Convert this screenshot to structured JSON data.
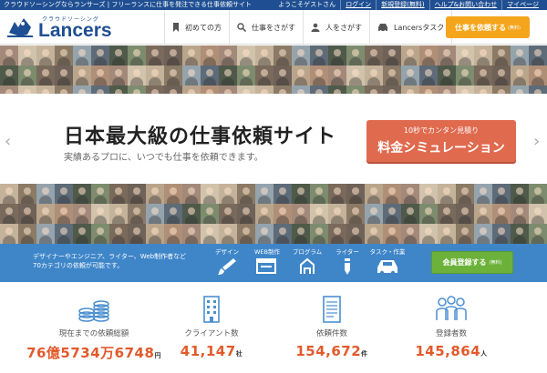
{
  "topbar": {
    "tagline": "クラウドソーシングならランサーズ | フリーランスに仕事を発注できる仕事依頼サイト",
    "links": [
      "ようこそゲストさん",
      "ログイン",
      "新規登録(無料)",
      "ヘルプ&お問い合わせ",
      "マイページ"
    ]
  },
  "header": {
    "logo_sub": "クラウドソーシング",
    "logo_text": "Lancers",
    "nav": [
      {
        "label": "初めての方",
        "icon": "bookmark-icon"
      },
      {
        "label": "仕事をさがす",
        "icon": "search-icon"
      },
      {
        "label": "人をさがす",
        "icon": "person-icon"
      },
      {
        "label": "Lancersタスク",
        "icon": "car-icon"
      }
    ],
    "cta_label": "仕事を依頼する",
    "cta_small": "(無料)"
  },
  "hero": {
    "title": "日本最大級の仕事依頼サイト",
    "subtitle": "実績あるプロに、いつでも仕事を依頼できます。",
    "sim_small": "10秒でカンタン見積り",
    "sim_big": "料金シミュレーション",
    "prev_arrow": "‹",
    "next_arrow": "›"
  },
  "band": {
    "text_line1": "デザイナーやエンジニア、ライター、Web制作者など",
    "text_line2": "70カテゴリの依頼が可能です。",
    "categories": [
      {
        "label": "デザイン",
        "icon": "brush-icon"
      },
      {
        "label": "WEB制作",
        "icon": "browser-icon"
      },
      {
        "label": "プログラム",
        "icon": "code-icon"
      },
      {
        "label": "ライター",
        "icon": "pen-icon"
      },
      {
        "label": "タスク・作業",
        "icon": "car-icon"
      }
    ],
    "register_label": "会員登録する",
    "register_small": "(無料)"
  },
  "stats": [
    {
      "label": "現在までの依頼総額",
      "icon": "coins-icon",
      "value": "76億5734万6748",
      "unit": "円"
    },
    {
      "label": "クライアント数",
      "icon": "building-icon",
      "value": "41,147",
      "unit": "社"
    },
    {
      "label": "依頼件数",
      "icon": "document-icon",
      "value": "154,672",
      "unit": "件"
    },
    {
      "label": "登録者数",
      "icon": "people-icon",
      "value": "145,864",
      "unit": "人"
    }
  ],
  "colors": {
    "brand_blue": "#1f4f92",
    "band_blue": "#3f86c9",
    "cta_orange": "#f4a51c",
    "sim_red": "#e06a4e",
    "register_green": "#6cb23a",
    "stat_orange": "#e25a2c"
  }
}
